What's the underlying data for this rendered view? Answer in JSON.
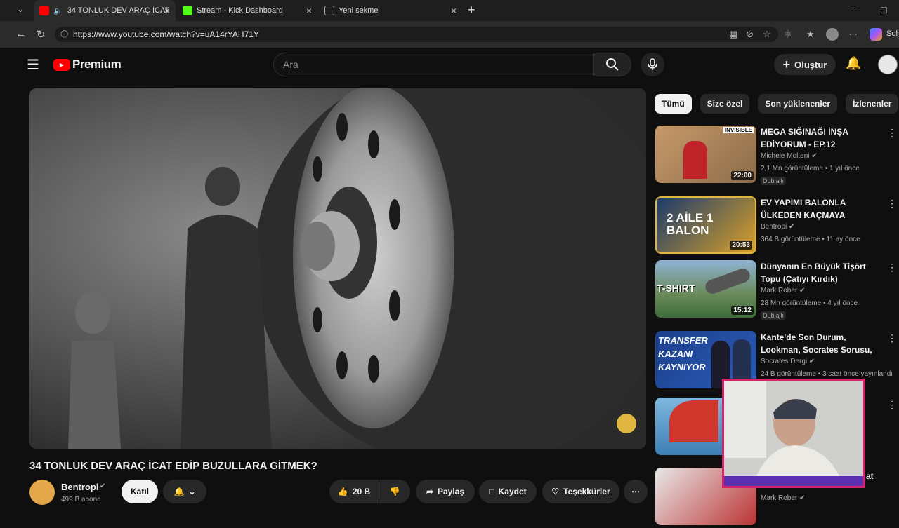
{
  "browser": {
    "tabs": [
      {
        "title": "34 TONLUK DEV ARAÇ İCAT E",
        "active": true
      },
      {
        "title": "Stream - Kick Dashboard",
        "active": false
      },
      {
        "title": "Yeni sekme",
        "active": false
      }
    ],
    "url": "https://www.youtube.com/watch?v=uA14rYAH71Y",
    "sidebar_label": "Soh"
  },
  "masthead": {
    "logo": "Premium",
    "search_placeholder": "Ara",
    "create_label": "Oluştur"
  },
  "video": {
    "title": "34 TONLUK DEV ARAÇ İCAT EDİP BUZULLARA GİTMEK?",
    "channel": "Bentropi",
    "subscribers": "499 B abone",
    "join_label": "Katıl",
    "likes": "20 B",
    "share_label": "Paylaş",
    "save_label": "Kaydet",
    "thanks_label": "Teşekkürler"
  },
  "chips": [
    "Tümü",
    "Size özel",
    "Son yüklenenler",
    "İzlenenler"
  ],
  "recommendations": [
    {
      "title": "MEGA SIĞINAĞI İNŞA EDİYORUM - EP.12",
      "channel": "Michele Molteni",
      "meta": "2,1 Mn görüntüleme • 1 yıl önce",
      "duration": "22:00",
      "badge": "Dublajlı",
      "thumb_text": "INVISIBLE"
    },
    {
      "title": "EV YAPIMI BALONLA ÜLKEDEN KAÇMAYA ÇALIŞAN AİLENİN ...",
      "channel": "Bentropi",
      "meta": "364 B görüntüleme • 11 ay önce",
      "duration": "20:53",
      "badge": "",
      "thumb_text": "2 AİLE 1 BALON"
    },
    {
      "title": "Dünyanın En Büyük Tişört Topu (Çatıyı Kırdık)",
      "channel": "Mark Rober",
      "meta": "28 Mn görüntüleme • 4 yıl önce",
      "duration": "15:12",
      "badge": "Dublajlı",
      "thumb_text": "T-SHIRT"
    },
    {
      "title": "Kante'de Son Durum, Lookman, Socrates Sorusu, Ekran Süresi ...",
      "channel": "Socrates Dergi",
      "meta": "24 B görüntüleme • 3 saat önce yayınlandı",
      "duration": "",
      "badge": "",
      "thumb_text": "TRANSFER KAZANI KAYNIYOR"
    },
    {
      "title": "",
      "channel": "",
      "meta": "",
      "duration": "",
      "badge": "",
      "thumb_text": ""
    },
    {
      "title": "at",
      "channel": "Mark Rober",
      "meta": "",
      "duration": "",
      "badge": "",
      "thumb_text": ""
    }
  ]
}
